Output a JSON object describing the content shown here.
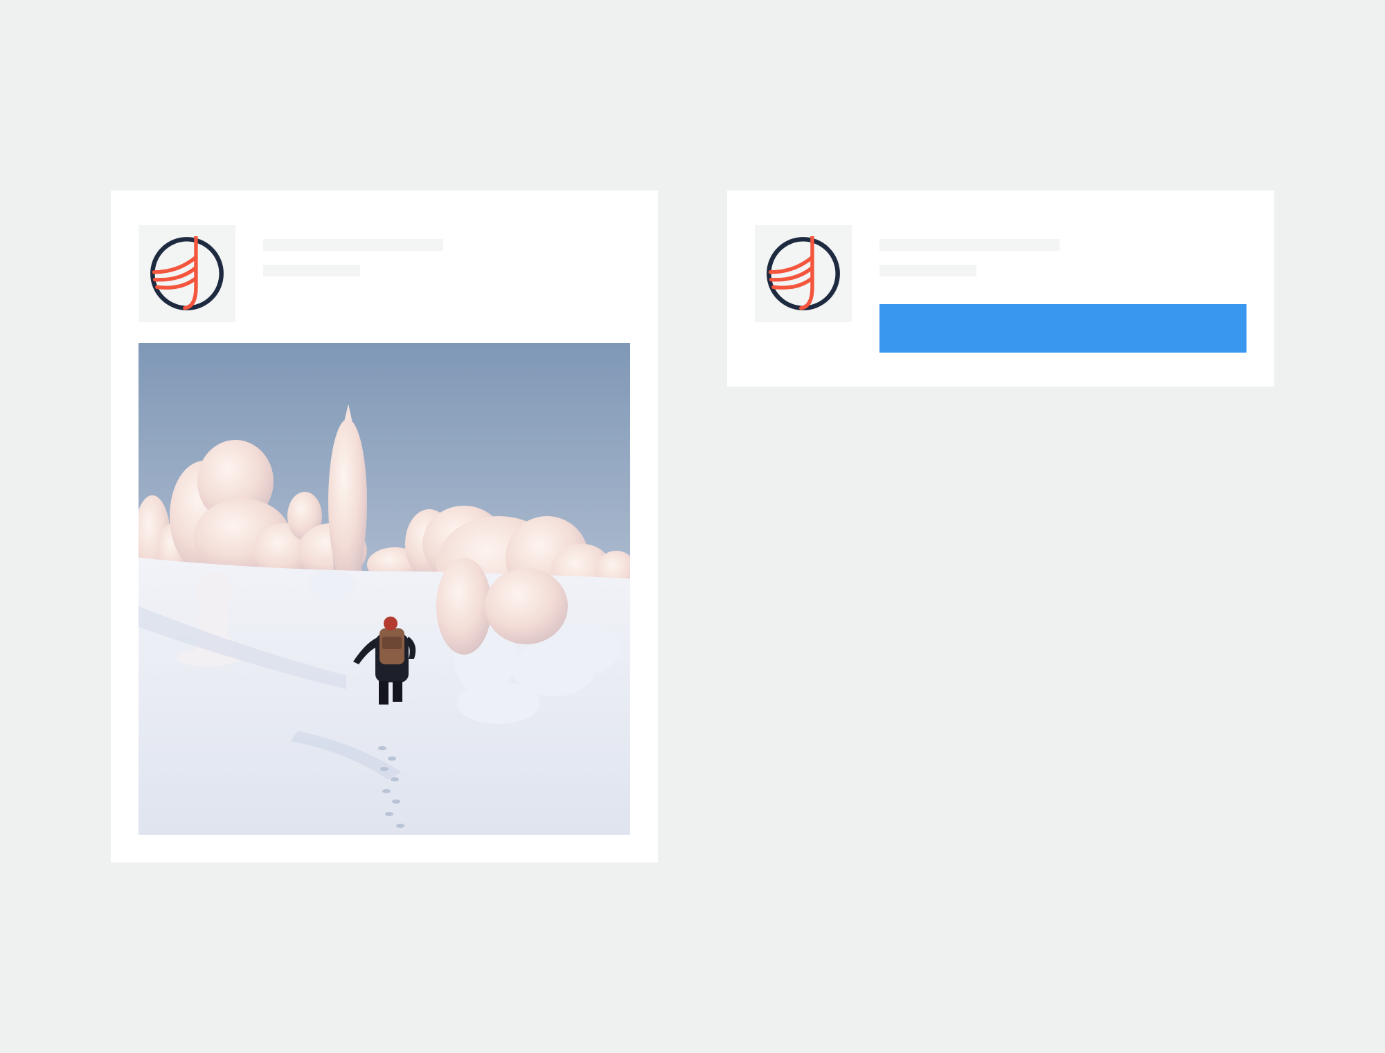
{
  "colors": {
    "background": "#eff0f0",
    "card": "#ffffff",
    "skeleton": "#f3f4f4",
    "button": "#3a97ef",
    "logo_ring": "#1d2a3f",
    "logo_accent": "#f4553d"
  },
  "cards": [
    {
      "avatar": {
        "icon": "brand-logo-icon"
      },
      "header": {
        "title_placeholder": true,
        "subtitle_placeholder": true
      },
      "media": {
        "kind": "photo",
        "subject": "hiker-in-snowy-forest"
      }
    },
    {
      "avatar": {
        "icon": "brand-logo-icon"
      },
      "header": {
        "title_placeholder": true,
        "subtitle_placeholder": true
      },
      "action": {
        "label": ""
      }
    }
  ]
}
